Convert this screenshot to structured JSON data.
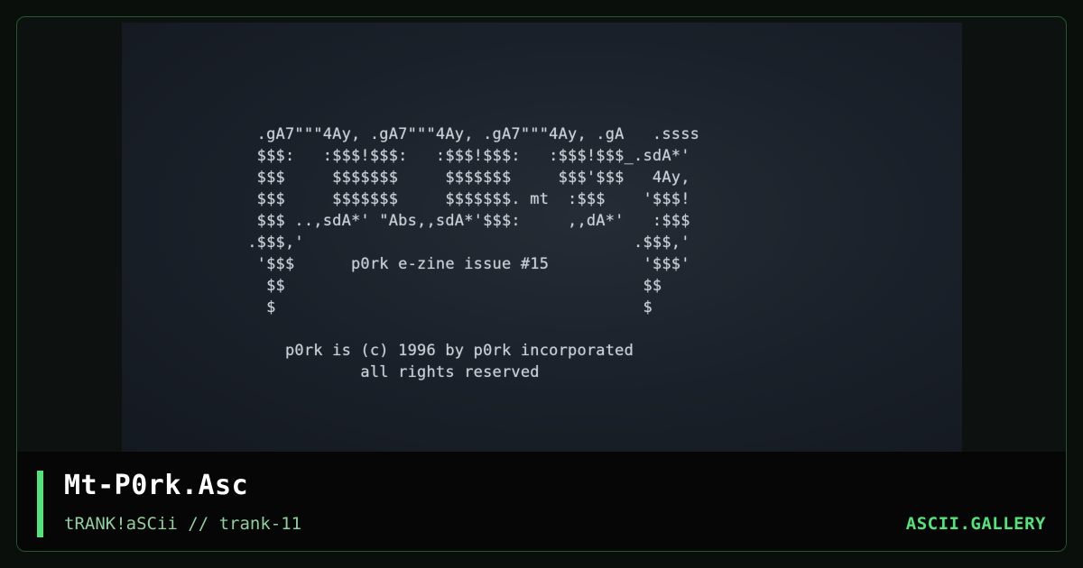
{
  "artwork": {
    "ascii_lines": [
      "             .gA7\"\"\"4Ay, .gA7\"\"\"4Ay, .gA7\"\"\"4Ay, .gA   .ssss",
      "             $$$:   :$$$!$$$:   :$$$!$$$:   :$$$!$$$_.sdA*'",
      "             $$$     $$$$$$$     $$$$$$$     $$$'$$$   4Ay,",
      "             $$$     $$$$$$$     $$$$$$$. mt  :$$$    '$$$!",
      "             $$$ ..,sdA*' \"Abs,,sdA*'$$$:     ,,dA*'   :$$$",
      "            .$$$,'                                   .$$$,'",
      "             '$$$      p0rk e-zine issue #15          '$$$'",
      "              $$                                      $$",
      "              $                                       $",
      "",
      "                p0rk is (c) 1996 by p0rk incorporated",
      "                        all rights reserved"
    ]
  },
  "caption": {
    "title": "Mt-P0rk.Asc",
    "subtitle": "tRANK!aSCii // trank-11",
    "brand": "ASCII.GALLERY"
  },
  "colors": {
    "accent": "#52e37a",
    "subtitle": "#8fcf9e",
    "art_text": "#c9cfd6",
    "border": "#1f5a2c"
  }
}
